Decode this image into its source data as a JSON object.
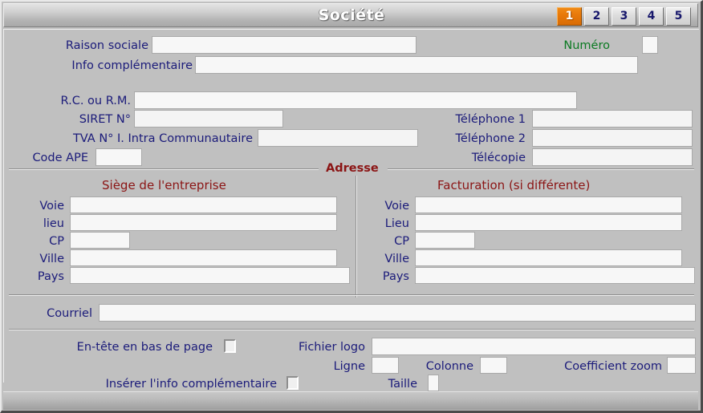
{
  "window": {
    "title": "Société"
  },
  "tabs": [
    {
      "label": "1",
      "active": true
    },
    {
      "label": "2",
      "active": false
    },
    {
      "label": "3",
      "active": false
    },
    {
      "label": "4",
      "active": false
    },
    {
      "label": "5",
      "active": false
    }
  ],
  "identity": {
    "raison_sociale_label": "Raison sociale",
    "raison_sociale_value": "",
    "numero_label": "Numéro",
    "numero_value": "",
    "info_complementaire_label": "Info complémentaire",
    "info_complementaire_value": ""
  },
  "legal": {
    "rc_rm_label": "R.C. ou R.M.",
    "rc_rm_value": "",
    "siret_label": "SIRET N°",
    "siret_value": "",
    "tva_label": "TVA N° I. Intra Communautaire",
    "tva_value": "",
    "code_ape_label": "Code APE",
    "code_ape_value": ""
  },
  "contact": {
    "telephone1_label": "Téléphone 1",
    "telephone1_value": "",
    "telephone2_label": "Téléphone 2",
    "telephone2_value": "",
    "telecopie_label": "Télécopie",
    "telecopie_value": ""
  },
  "adresse": {
    "legend": "Adresse",
    "siege": {
      "title": "Siège de l'entreprise",
      "voie_label": "Voie",
      "voie_value": "",
      "lieu_label": "lieu",
      "lieu_value": "",
      "cp_label": "CP",
      "cp_value": "",
      "ville_label": "Ville",
      "ville_value": "",
      "pays_label": "Pays",
      "pays_value": ""
    },
    "facturation": {
      "title": "Facturation (si différente)",
      "voie_label": "Voie",
      "voie_value": "",
      "lieu_label": "Lieu",
      "lieu_value": "",
      "cp_label": "CP",
      "cp_value": "",
      "ville_label": "Ville",
      "ville_value": "",
      "pays_label": "Pays",
      "pays_value": ""
    }
  },
  "courriel": {
    "label": "Courriel",
    "value": ""
  },
  "logo": {
    "entete_bas_page_label": "En-tête en bas de page",
    "entete_bas_page_checked": false,
    "inserer_info_label": "Insérer l'info complémentaire",
    "inserer_info_checked": false,
    "fichier_logo_label": "Fichier logo",
    "fichier_logo_value": "",
    "ligne_label": "Ligne",
    "ligne_value": "",
    "colonne_label": "Colonne",
    "colonne_value": "",
    "coefficient_zoom_label": "Coefficient zoom",
    "coefficient_zoom_value": "",
    "taille_label": "Taille",
    "taille_value": ""
  },
  "colors": {
    "label_blue": "#1b1b7a",
    "label_green": "#0b7a22",
    "section_red": "#8b1414",
    "tab_active": "#e8790a",
    "window_bg": "#c0c0c0",
    "field_bg": "#f7f7f7"
  }
}
